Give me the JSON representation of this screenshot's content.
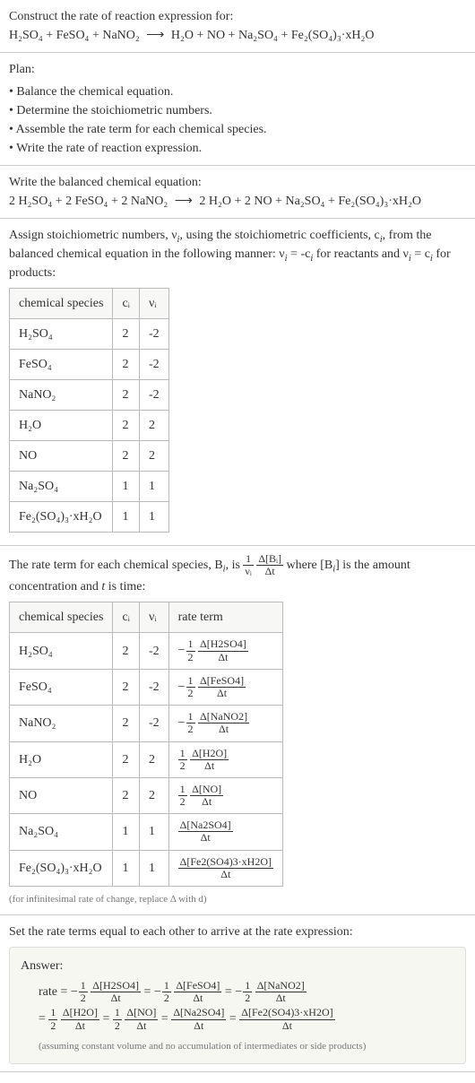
{
  "intro": {
    "prompt": "Construct the rate of reaction expression for:",
    "equation_lhs": "H₂SO₄ + FeSO₄ + NaNO₂",
    "equation_rhs": "H₂O + NO + Na₂SO₄ + Fe₂(SO₄)₃·xH₂O"
  },
  "plan": {
    "heading": "Plan:",
    "items": [
      "Balance the chemical equation.",
      "Determine the stoichiometric numbers.",
      "Assemble the rate term for each chemical species.",
      "Write the rate of reaction expression."
    ]
  },
  "balanced": {
    "heading": "Write the balanced chemical equation:",
    "equation_lhs": "2 H₂SO₄ + 2 FeSO₄ + 2 NaNO₂",
    "equation_rhs": "2 H₂O + 2 NO + Na₂SO₄ + Fe₂(SO₄)₃·xH₂O"
  },
  "assign": {
    "text_a": "Assign stoichiometric numbers, ν",
    "text_b": ", using the stoichiometric coefficients, c",
    "text_c": ", from the balanced chemical equation in the following manner: ν",
    "text_d": " = -c",
    "text_e": " for reactants and ν",
    "text_f": " = c",
    "text_g": " for products:",
    "sub": "i"
  },
  "table1": {
    "headers": [
      "chemical species",
      "cᵢ",
      "νᵢ"
    ],
    "rows": [
      {
        "species": "H₂SO₄",
        "c": "2",
        "v": "-2"
      },
      {
        "species": "FeSO₄",
        "c": "2",
        "v": "-2"
      },
      {
        "species": "NaNO₂",
        "c": "2",
        "v": "-2"
      },
      {
        "species": "H₂O",
        "c": "2",
        "v": "2"
      },
      {
        "species": "NO",
        "c": "2",
        "v": "2"
      },
      {
        "species": "Na₂SO₄",
        "c": "1",
        "v": "1"
      },
      {
        "species": "Fe₂(SO₄)₃·xH₂O",
        "c": "1",
        "v": "1"
      }
    ]
  },
  "rateterm_text": {
    "a": "The rate term for each chemical species, B",
    "b": ", is ",
    "c": " where [B",
    "d": "] is the amount concentration and ",
    "e": " is time:",
    "t": "t",
    "frac1_num": "1",
    "frac1_den": "νᵢ",
    "frac2_num": "Δ[Bᵢ]",
    "frac2_den": "Δt"
  },
  "table2": {
    "headers": [
      "chemical species",
      "cᵢ",
      "νᵢ",
      "rate term"
    ],
    "rows": [
      {
        "species": "H₂SO₄",
        "c": "2",
        "v": "-2",
        "sign": "−",
        "coef_num": "1",
        "coef_den": "2",
        "dnum": "Δ[H2SO4]",
        "dden": "Δt"
      },
      {
        "species": "FeSO₄",
        "c": "2",
        "v": "-2",
        "sign": "−",
        "coef_num": "1",
        "coef_den": "2",
        "dnum": "Δ[FeSO4]",
        "dden": "Δt"
      },
      {
        "species": "NaNO₂",
        "c": "2",
        "v": "-2",
        "sign": "−",
        "coef_num": "1",
        "coef_den": "2",
        "dnum": "Δ[NaNO2]",
        "dden": "Δt"
      },
      {
        "species": "H₂O",
        "c": "2",
        "v": "2",
        "sign": "",
        "coef_num": "1",
        "coef_den": "2",
        "dnum": "Δ[H2O]",
        "dden": "Δt"
      },
      {
        "species": "NO",
        "c": "2",
        "v": "2",
        "sign": "",
        "coef_num": "1",
        "coef_den": "2",
        "dnum": "Δ[NO]",
        "dden": "Δt"
      },
      {
        "species": "Na₂SO₄",
        "c": "1",
        "v": "1",
        "sign": "",
        "coef_num": "",
        "coef_den": "",
        "dnum": "Δ[Na2SO4]",
        "dden": "Δt"
      },
      {
        "species": "Fe₂(SO₄)₃·xH₂O",
        "c": "1",
        "v": "1",
        "sign": "",
        "coef_num": "",
        "coef_den": "",
        "dnum": "Δ[Fe2(SO4)3·xH2O]",
        "dden": "Δt"
      }
    ],
    "footnote": "(for infinitesimal rate of change, replace Δ with d)"
  },
  "final": {
    "heading": "Set the rate terms equal to each other to arrive at the rate expression:",
    "answer_label": "Answer:",
    "rate_label": "rate",
    "terms_line1": [
      {
        "sign": "−",
        "coef_num": "1",
        "coef_den": "2",
        "dnum": "Δ[H2SO4]",
        "dden": "Δt"
      },
      {
        "sign": "−",
        "coef_num": "1",
        "coef_den": "2",
        "dnum": "Δ[FeSO4]",
        "dden": "Δt"
      },
      {
        "sign": "−",
        "coef_num": "1",
        "coef_den": "2",
        "dnum": "Δ[NaNO2]",
        "dden": "Δt"
      }
    ],
    "terms_line2": [
      {
        "sign": "",
        "coef_num": "1",
        "coef_den": "2",
        "dnum": "Δ[H2O]",
        "dden": "Δt"
      },
      {
        "sign": "",
        "coef_num": "1",
        "coef_den": "2",
        "dnum": "Δ[NO]",
        "dden": "Δt"
      },
      {
        "sign": "",
        "coef_num": "",
        "coef_den": "",
        "dnum": "Δ[Na2SO4]",
        "dden": "Δt"
      },
      {
        "sign": "",
        "coef_num": "",
        "coef_den": "",
        "dnum": "Δ[Fe2(SO4)3·xH2O]",
        "dden": "Δt"
      }
    ],
    "caption": "(assuming constant volume and no accumulation of intermediates or side products)"
  }
}
